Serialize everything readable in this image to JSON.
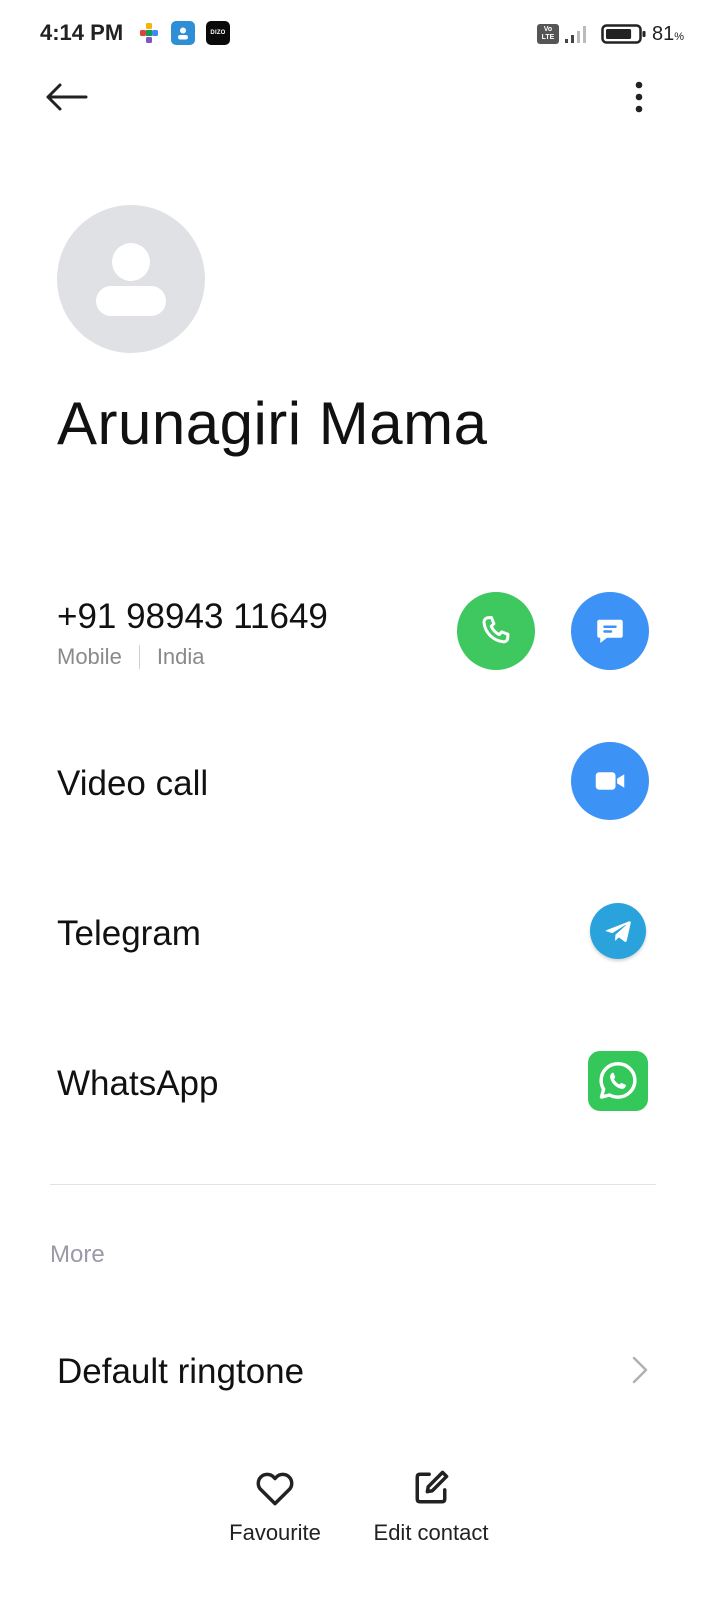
{
  "status_bar": {
    "time": "4:14 PM",
    "app_icons": [
      "puzzle-icon",
      "contacts-app-icon",
      "dizo-app-icon"
    ],
    "dizo_label": "DIZO",
    "volte_top": "Vo",
    "volte_bottom": "LTE",
    "battery_level": 81,
    "battery_text": "81",
    "battery_unit": "%"
  },
  "top_bar": {
    "back_icon": "arrow-left-icon",
    "more_icon": "more-vertical-icon"
  },
  "contact": {
    "name": "Arunagiri Mama",
    "avatar_icon": "person-placeholder-icon"
  },
  "phone": {
    "number": "+91 98943 11649",
    "type": "Mobile",
    "location": "India",
    "call_icon": "phone-icon",
    "message_icon": "message-icon"
  },
  "actions": {
    "video_call": "Video call",
    "telegram": "Telegram",
    "whatsapp": "WhatsApp"
  },
  "more_section": {
    "header": "More",
    "default_ringtone": "Default ringtone"
  },
  "bottom_bar": {
    "favourite": "Favourite",
    "edit_contact": "Edit contact"
  },
  "colors": {
    "call_green": "#3ec85f",
    "action_blue": "#3d92f5",
    "telegram_blue": "#2aa3dd",
    "whatsapp_green": "#34c759",
    "avatar_gray": "#dfe1e4"
  }
}
